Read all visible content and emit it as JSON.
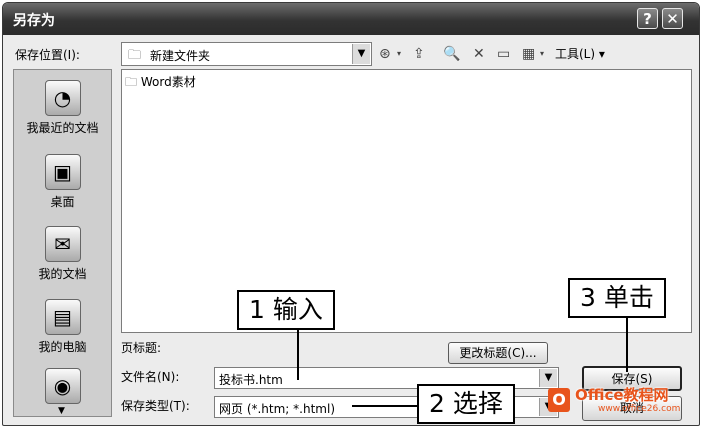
{
  "dialog": {
    "title": "另存为",
    "help_button": "?",
    "close_button": "✕"
  },
  "save_location": {
    "label": "保存位置(I):",
    "value": "新建文件夹"
  },
  "toolbar": {
    "tools_label": "工具(L)"
  },
  "sidebar": {
    "items": [
      {
        "label": "我最近的文档",
        "icon": "recent-documents-icon"
      },
      {
        "label": "桌面",
        "icon": "desktop-icon"
      },
      {
        "label": "我的文档",
        "icon": "my-documents-icon"
      },
      {
        "label": "我的电脑",
        "icon": "my-computer-icon"
      },
      {
        "label": "",
        "icon": "network-places-icon"
      }
    ]
  },
  "files": [
    {
      "name": "Word素材",
      "type": "folder"
    }
  ],
  "page_title": {
    "label": "页标题:",
    "change_button": "更改标题(C)..."
  },
  "file_name": {
    "label": "文件名(N):",
    "value": "投标书.htm"
  },
  "file_type": {
    "label": "保存类型(T):",
    "value": "网页 (*.htm; *.html)"
  },
  "buttons": {
    "save": "保存(S)",
    "cancel": "取消"
  },
  "callouts": {
    "input": "1 输入",
    "select": "2 选择",
    "click": "3 单击"
  },
  "watermark": {
    "logo_letter": "O",
    "brand": "Office教程网",
    "url": "www.office26.com"
  },
  "colors": {
    "titlebar": "#333333",
    "dialog_bg": "#ececec",
    "sidebar_bg": "#cfcfcf",
    "watermark": "#e8541c"
  }
}
